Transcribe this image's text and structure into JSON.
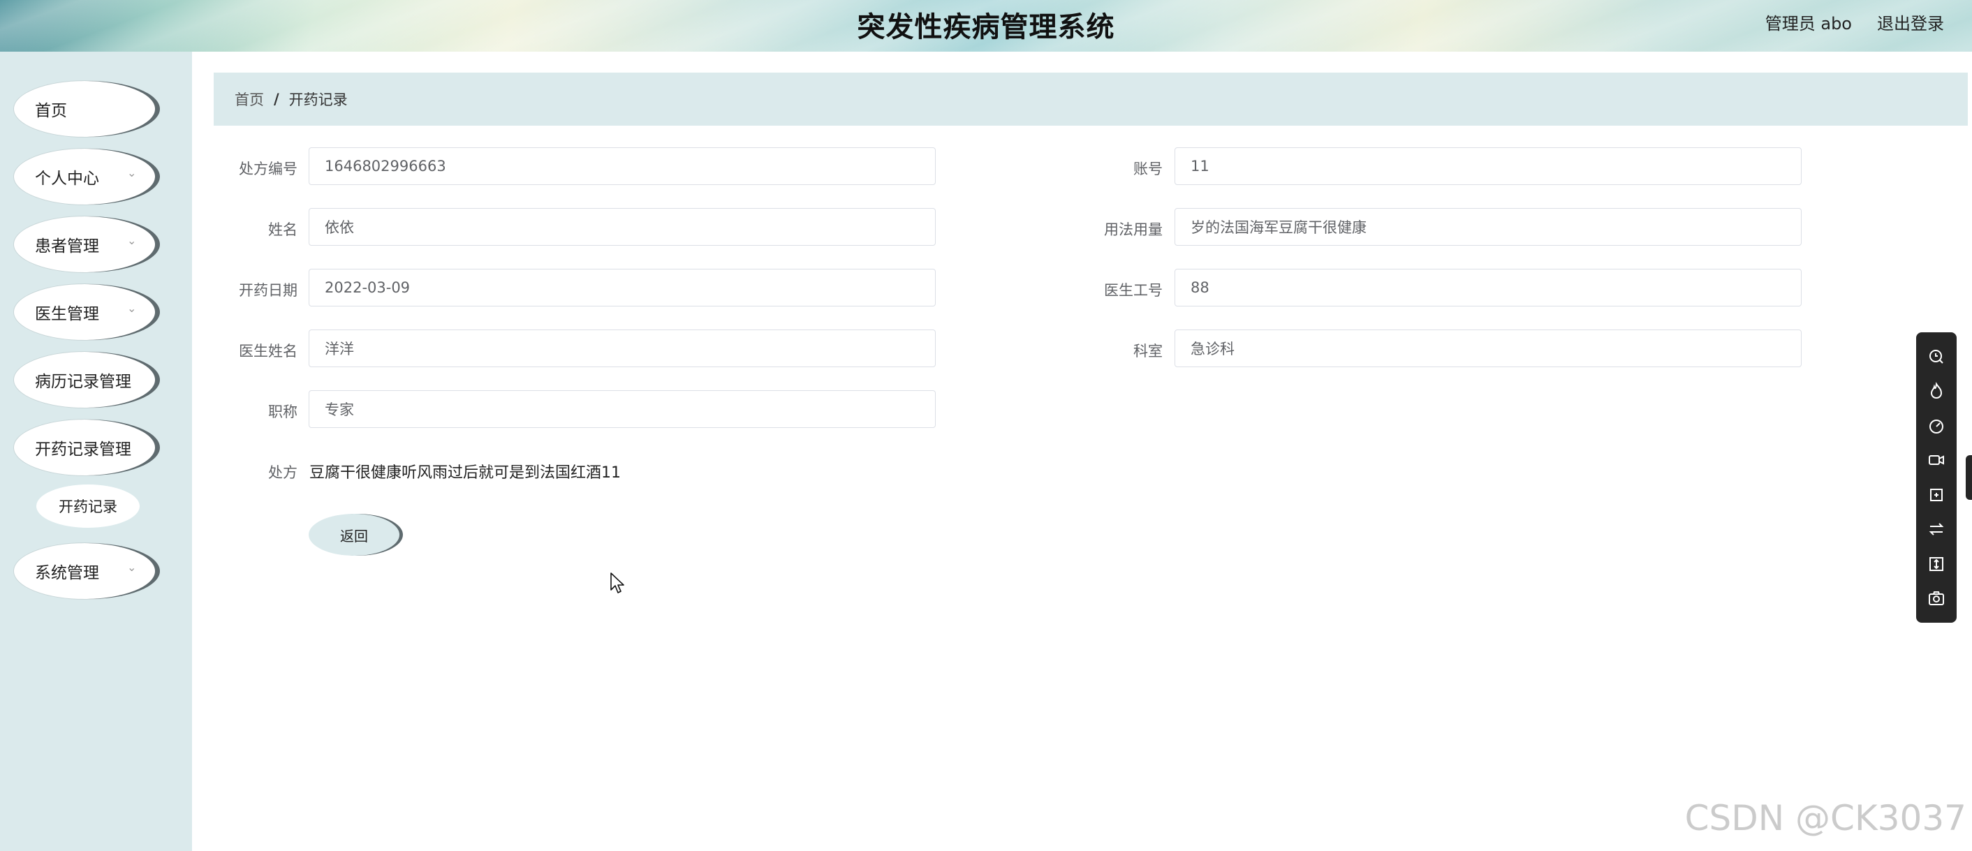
{
  "header": {
    "title": "突发性疾病管理系统",
    "admin": "管理员 abo",
    "logout": "退出登录"
  },
  "sidebar": {
    "items": [
      {
        "label": "首页"
      },
      {
        "label": "个人中心"
      },
      {
        "label": "患者管理"
      },
      {
        "label": "医生管理"
      },
      {
        "label": "病历记录管理"
      },
      {
        "label": "开药记录管理"
      },
      {
        "label": "开药记录"
      },
      {
        "label": "系统管理"
      }
    ]
  },
  "breadcrumb": {
    "home": "首页",
    "separator": "/",
    "current": "开药记录"
  },
  "form": {
    "prescription_no": {
      "label": "处方编号",
      "value": "1646802996663"
    },
    "account": {
      "label": "账号",
      "value": "11"
    },
    "name": {
      "label": "姓名",
      "value": "依依"
    },
    "usage": {
      "label": "用法用量",
      "value": "岁的法国海军豆腐干很健康"
    },
    "date": {
      "label": "开药日期",
      "value": "2022-03-09"
    },
    "doctor_id": {
      "label": "医生工号",
      "value": "88"
    },
    "doctor_name": {
      "label": "医生姓名",
      "value": "洋洋"
    },
    "department": {
      "label": "科室",
      "value": "急诊科"
    },
    "title": {
      "label": "职称",
      "value": "专家"
    },
    "prescription": {
      "label": "处方",
      "value": "豆腐干很健康听风雨过后就可是到法国红酒11"
    },
    "back_label": "返回"
  },
  "toolbar": {
    "icons": [
      "search-icon",
      "fire-icon",
      "speed-icon",
      "video-icon",
      "crop-icon",
      "swap-icon",
      "resize-icon",
      "camera-icon"
    ]
  },
  "watermark": "CSDN @CK3037"
}
